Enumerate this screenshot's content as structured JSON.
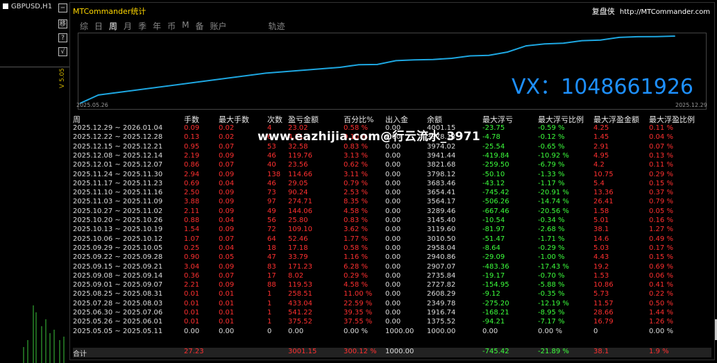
{
  "symbol": "GBPUSD,H1",
  "version_label": "V 5.05",
  "panel_title": "MTCommander统计",
  "brand": "复盘侠",
  "brand_url": "http://MTCommander.com",
  "tabs": [
    "综",
    "日",
    "周",
    "月",
    "季",
    "年",
    "币",
    "M",
    "备",
    "账户",
    "轨迹"
  ],
  "active_tab": "周",
  "side_buttons": [
    "移",
    "?",
    "√"
  ],
  "vx_text": "VX：1048661926",
  "watermark": "www.eazhijia.com@行云流水_3971",
  "chart_data": {
    "type": "line",
    "x": [
      "2025.05.26",
      "2025.06.30",
      "2025.07.28",
      "2025.08.25",
      "2025.09.01",
      "2025.09.08",
      "2025.09.15",
      "2025.09.22",
      "2025.09.29",
      "2025.10.06",
      "2025.10.13",
      "2025.10.20",
      "2025.10.27",
      "2025.11.03",
      "2025.11.10",
      "2025.11.17",
      "2025.11.24",
      "2025.12.01",
      "2025.12.08",
      "2025.12.15",
      "2025.12.22",
      "2025.12.29"
    ],
    "values": [
      1375.52,
      1916.74,
      2349.78,
      2608.29,
      2727.82,
      2735.84,
      2907.07,
      2940.86,
      2958.04,
      3010.5,
      3119.6,
      3145.4,
      3289.46,
      3564.17,
      3654.41,
      3683.46,
      3798.12,
      3821.68,
      3941.44,
      3974.02,
      3978.13,
      4001.15
    ],
    "xtick_start": "2025.05.26",
    "xtick_end": "2025.12.29",
    "color": "#1ea7e1"
  },
  "table": {
    "headers": [
      "周",
      "手数",
      "最大手数",
      "次数",
      "盈亏金额",
      "百分比%",
      "出入金",
      "余额",
      "最大浮亏",
      "最大浮亏比例",
      "最大浮盈金额",
      "最大浮盈比例"
    ],
    "rows": [
      [
        "2025.12.29 ~ 2026.01.04",
        "0.09",
        "0.02",
        "4",
        "23.02",
        "0.58 %",
        "0.00",
        "4001.15",
        "-23.75",
        "-0.59 %",
        "4.25",
        "0.11 %"
      ],
      [
        "2025.12.22 ~ 2025.12.28",
        "0.13",
        "0.02",
        "6",
        "4.11",
        "0.10 %",
        "0.00",
        "3978.13",
        "-4.78",
        "-0.12 %",
        "1.45",
        "0.04 %"
      ],
      [
        "2025.12.15 ~ 2025.12.21",
        "0.95",
        "0.07",
        "53",
        "32.58",
        "0.83 %",
        "0.00",
        "3974.02",
        "-25.54",
        "-0.65 %",
        "2.91",
        "0.07 %"
      ],
      [
        "2025.12.08 ~ 2025.12.14",
        "2.19",
        "0.09",
        "46",
        "119.76",
        "3.13 %",
        "0.00",
        "3941.44",
        "-419.84",
        "-10.92 %",
        "4.95",
        "0.13 %"
      ],
      [
        "2025.12.01 ~ 2025.12.07",
        "0.86",
        "0.07",
        "40",
        "23.56",
        "0.62 %",
        "0.00",
        "3821.68",
        "-259.50",
        "-6.79 %",
        "4.2",
        "0.11 %"
      ],
      [
        "2025.11.24 ~ 2025.11.30",
        "2.94",
        "0.09",
        "138",
        "114.66",
        "3.11 %",
        "0.00",
        "3798.12",
        "-50.10",
        "-1.33 %",
        "10.75",
        "0.29 %"
      ],
      [
        "2025.11.17 ~ 2025.11.23",
        "0.69",
        "0.04",
        "46",
        "29.05",
        "0.79 %",
        "0.00",
        "3683.46",
        "-43.12",
        "-1.17 %",
        "5.4",
        "0.15 %"
      ],
      [
        "2025.11.10 ~ 2025.11.16",
        "2.50",
        "0.09",
        "73",
        "90.24",
        "2.53 %",
        "0.00",
        "3654.41",
        "-745.42",
        "-20.91 %",
        "13.36",
        "0.37 %"
      ],
      [
        "2025.11.03 ~ 2025.11.09",
        "3.88",
        "0.09",
        "97",
        "274.71",
        "8.35 %",
        "0.00",
        "3564.17",
        "-506.26",
        "-14.74 %",
        "26.41",
        "0.79 %"
      ],
      [
        "2025.10.27 ~ 2025.11.02",
        "2.11",
        "0.09",
        "49",
        "144.06",
        "4.58 %",
        "0.00",
        "3289.46",
        "-667.46",
        "-20.56 %",
        "1.58",
        "0.05 %"
      ],
      [
        "2025.10.20 ~ 2025.10.26",
        "0.88",
        "0.04",
        "56",
        "25.80",
        "0.83 %",
        "0.00",
        "3145.40",
        "-10.54",
        "-0.34 %",
        "5.01",
        "0.16 %"
      ],
      [
        "2025.10.13 ~ 2025.10.19",
        "1.54",
        "0.09",
        "72",
        "109.10",
        "3.62 %",
        "0.00",
        "3119.60",
        "-81.97",
        "-2.68 %",
        "38.1",
        "1.27 %"
      ],
      [
        "2025.10.06 ~ 2025.10.12",
        "1.07",
        "0.07",
        "64",
        "52.46",
        "1.77 %",
        "0.00",
        "3010.50",
        "-51.47",
        "-1.71 %",
        "14.6",
        "0.49 %"
      ],
      [
        "2025.09.29 ~ 2025.10.05",
        "0.25",
        "0.04",
        "18",
        "17.18",
        "0.58 %",
        "0.00",
        "2958.04",
        "-8.64",
        "-0.29 %",
        "5.03",
        "0.17 %"
      ],
      [
        "2025.09.22 ~ 2025.09.28",
        "0.90",
        "0.05",
        "47",
        "33.79",
        "1.16 %",
        "0.00",
        "2940.86",
        "-29.09",
        "-1.00 %",
        "4.43",
        "0.15 %"
      ],
      [
        "2025.09.15 ~ 2025.09.21",
        "3.04",
        "0.09",
        "83",
        "171.23",
        "6.28 %",
        "0.00",
        "2907.07",
        "-483.36",
        "-17.43 %",
        "19.2",
        "0.69 %"
      ],
      [
        "2025.09.08 ~ 2025.09.14",
        "0.36",
        "0.07",
        "17",
        "8.02",
        "0.29 %",
        "0.00",
        "2735.84",
        "-19.17",
        "-0.70 %",
        "1.53",
        "0.06 %"
      ],
      [
        "2025.09.01 ~ 2025.09.07",
        "2.21",
        "0.09",
        "88",
        "119.53",
        "4.58 %",
        "0.00",
        "2727.82",
        "-154.95",
        "-5.88 %",
        "10.86",
        "0.41 %"
      ],
      [
        "2025.08.25 ~ 2025.08.31",
        "0.01",
        "0.01",
        "1",
        "258.51",
        "11.00 %",
        "0.00",
        "2608.29",
        "-9.12",
        "-0.35 %",
        "5.73",
        "0.22 %"
      ],
      [
        "2025.07.28 ~ 2025.08.03",
        "0.01",
        "0.01",
        "1",
        "433.04",
        "22.59 %",
        "0.00",
        "2349.78",
        "-275.20",
        "-12.19 %",
        "11.57",
        "0.50 %"
      ],
      [
        "2025.06.30 ~ 2025.07.06",
        "0.01",
        "0.01",
        "1",
        "541.22",
        "39.35 %",
        "0.00",
        "1916.74",
        "-168.21",
        "-8.95 %",
        "28.66",
        "1.44 %"
      ],
      [
        "2025.05.26 ~ 2025.06.01",
        "0.01",
        "0.01",
        "1",
        "375.52",
        "37.55 %",
        "0.00",
        "1375.52",
        "-94.21",
        "-7.17 %",
        "16.79",
        "1.26 %"
      ],
      [
        "2025.05.05 ~ 2025.05.11",
        "0.00",
        "0.00",
        "0",
        "0.00",
        "0.00 %",
        "1000.00",
        "1000.00",
        "0.00",
        "0.00 %",
        "0",
        "0.00 %"
      ]
    ],
    "total": [
      "合计",
      "27.23",
      "",
      "",
      "3001.15",
      "300.12 %",
      "1000.00",
      "",
      "-745.42",
      "-21.89 %",
      "38.1",
      "1.9 %"
    ]
  }
}
